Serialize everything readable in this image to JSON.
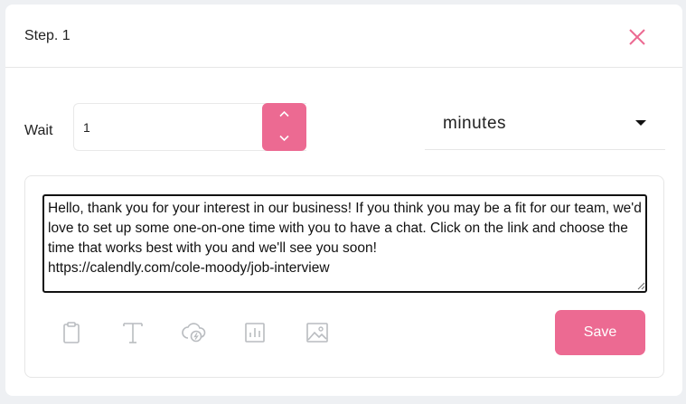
{
  "modal": {
    "title": "Step. 1"
  },
  "wait": {
    "label": "Wait",
    "value": "1",
    "unit": "minutes"
  },
  "message": {
    "text": "Hello, thank you for your interest in our business! If you think you may be a fit for our team, we'd love to set up some one-on-one time with you to have a chat. Click on the link and choose the time that works best with you and we'll see you soon!\nhttps://calendly.com/cole-moody/job-interview"
  },
  "toolbar": {
    "icons": [
      "clipboard-icon",
      "text-icon",
      "link-icon",
      "chart-icon",
      "image-icon"
    ],
    "save_label": "Save"
  },
  "colors": {
    "accent": "#ec6a92",
    "icon_gray": "#b9bcc0"
  }
}
